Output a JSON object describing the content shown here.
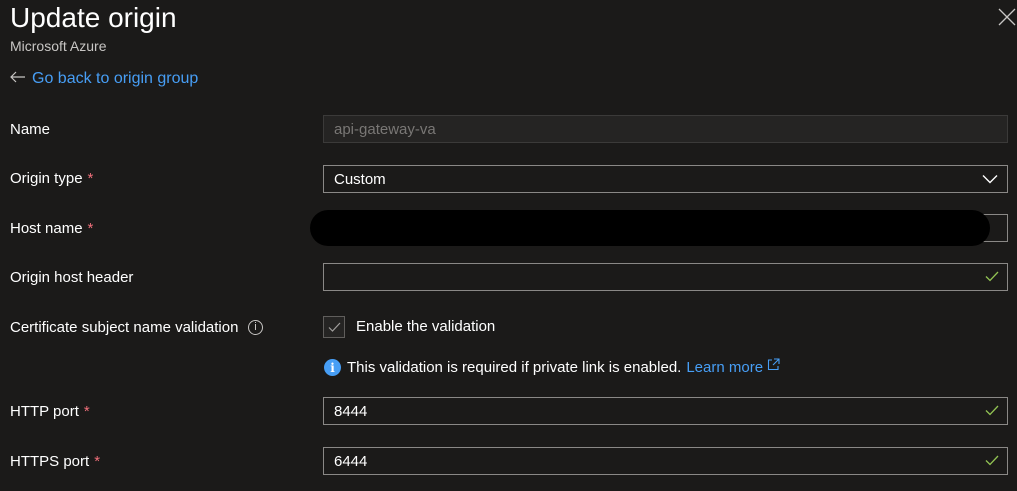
{
  "header": {
    "title": "Update origin",
    "subtitle": "Microsoft Azure"
  },
  "nav": {
    "back_link": "Go back to origin group"
  },
  "form": {
    "name": {
      "label": "Name",
      "value": "api-gateway-va"
    },
    "origin_type": {
      "label": "Origin type",
      "required": "*",
      "value": "Custom"
    },
    "host_name": {
      "label": "Host name",
      "required": "*",
      "value": ""
    },
    "origin_host_header": {
      "label": "Origin host header",
      "value": ""
    },
    "cert_validation": {
      "label": "Certificate subject name validation",
      "checkbox_label": "Enable the validation",
      "checked": true
    },
    "info": {
      "text": "This validation is required if private link is enabled.",
      "link": "Learn more"
    },
    "http_port": {
      "label": "HTTP port",
      "required": "*",
      "value": "8444"
    },
    "https_port": {
      "label": "HTTPS port",
      "required": "*",
      "value": "6444"
    }
  },
  "colors": {
    "background": "#1b1a19",
    "link": "#479ef5",
    "required": "#f1707b",
    "valid_check": "#92c353"
  }
}
